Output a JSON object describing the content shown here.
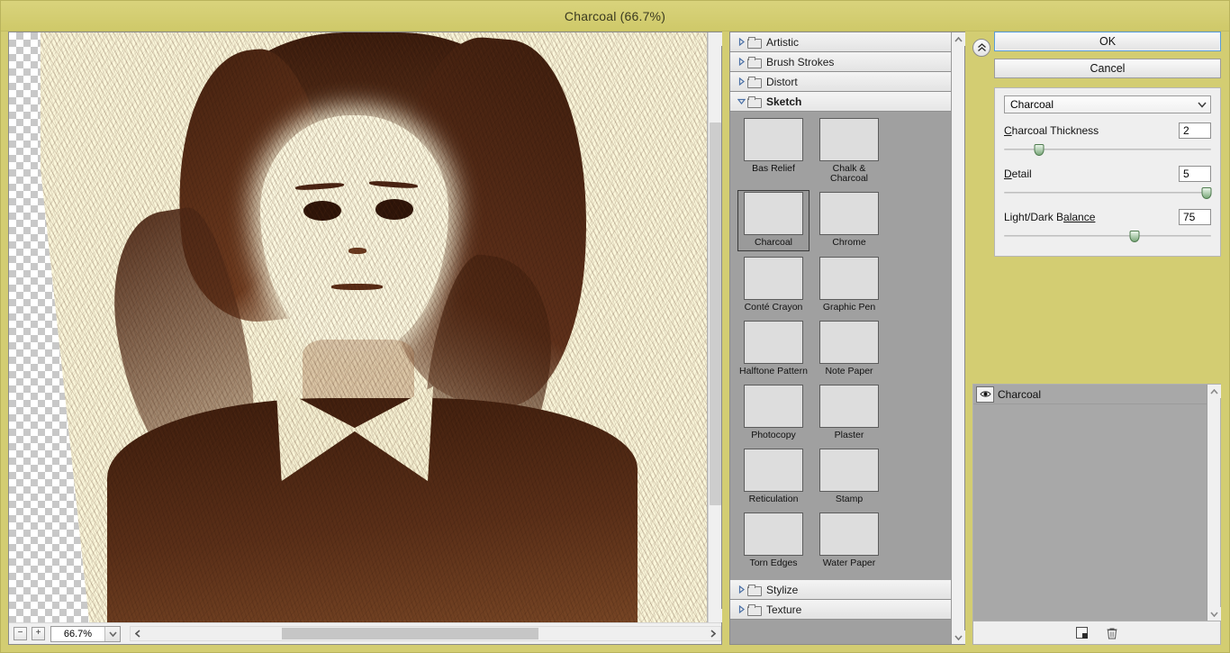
{
  "window": {
    "title": "Charcoal (66.7%)"
  },
  "preview": {
    "zoom_out_label": "−",
    "zoom_in_label": "+",
    "zoom_value": "66.7%",
    "zoom_dropdown_icon": "chevron-down-icon",
    "hscroll_left_icon": "chevron-left-icon",
    "hscroll_right_icon": "chevron-right-icon",
    "vscroll_up_icon": "chevron-up-icon",
    "vscroll_down_icon": "chevron-down-icon"
  },
  "gallery": {
    "categories": [
      {
        "label": "Artistic",
        "expanded": false
      },
      {
        "label": "Brush Strokes",
        "expanded": false
      },
      {
        "label": "Distort",
        "expanded": false
      },
      {
        "label": "Sketch",
        "expanded": true
      },
      {
        "label": "Stylize",
        "expanded": false
      },
      {
        "label": "Texture",
        "expanded": false
      }
    ],
    "filters": [
      {
        "label": "Bas Relief",
        "selected": false
      },
      {
        "label": "Chalk & Charcoal",
        "selected": false
      },
      {
        "label": "Charcoal",
        "selected": true
      },
      {
        "label": "Chrome",
        "selected": false
      },
      {
        "label": "Conté Crayon",
        "selected": false
      },
      {
        "label": "Graphic Pen",
        "selected": false
      },
      {
        "label": "Halftone Pattern",
        "selected": false
      },
      {
        "label": "Note Paper",
        "selected": false
      },
      {
        "label": "Photocopy",
        "selected": false
      },
      {
        "label": "Plaster",
        "selected": false
      },
      {
        "label": "Reticulation",
        "selected": false
      },
      {
        "label": "Stamp",
        "selected": false
      },
      {
        "label": "Torn Edges",
        "selected": false
      },
      {
        "label": "Water Paper",
        "selected": false
      }
    ],
    "scroll_up_icon": "chevron-up-icon",
    "scroll_down_icon": "chevron-down-icon"
  },
  "settings": {
    "collapse_icon": "double-chevron-up-icon",
    "ok_label": "OK",
    "cancel_label": "Cancel",
    "filter_select": "Charcoal",
    "select_arrow_icon": "chevron-down-icon",
    "sliders": [
      {
        "label_pre": "C",
        "label_post": "harcoal Thickness",
        "value": "2",
        "percent": 17
      },
      {
        "label_pre": "D",
        "label_post": "etail",
        "value": "5",
        "percent": 98
      },
      {
        "label_pre": "Light/Dark B",
        "label_post": "alance",
        "value": "75",
        "percent": 63
      }
    ]
  },
  "layers": {
    "items": [
      {
        "name": "Charcoal",
        "visible": true,
        "eye_icon": "eye-icon"
      }
    ],
    "new_layer_icon": "new-effect-layer-icon",
    "delete_layer_icon": "trash-icon",
    "scroll_up_icon": "chevron-up-icon",
    "scroll_down_icon": "chevron-down-icon"
  }
}
